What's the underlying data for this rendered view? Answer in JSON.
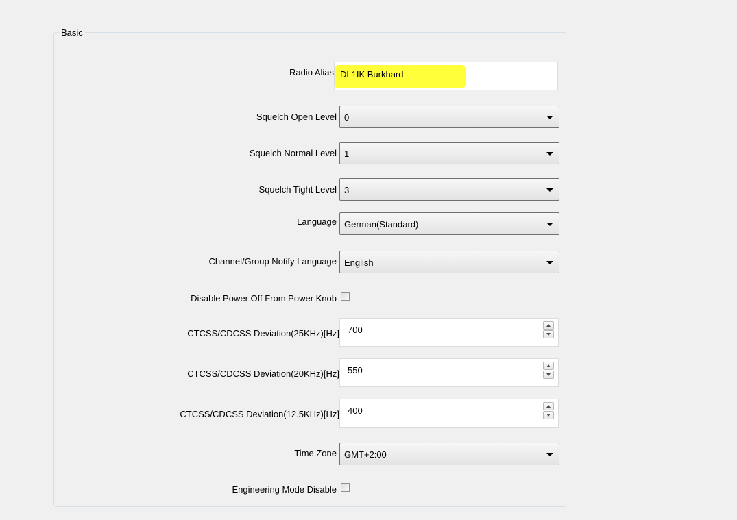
{
  "group": {
    "title": "Basic"
  },
  "fields": {
    "radio_alias": {
      "label": "Radio Alias",
      "value": "DL1IK Burkhard",
      "highlight_color": "#ffff3a"
    },
    "squelch_open": {
      "label": "Squelch Open Level",
      "value": "0"
    },
    "squelch_normal": {
      "label": "Squelch Normal Level",
      "value": "1"
    },
    "squelch_tight": {
      "label": "Squelch Tight Level",
      "value": "3"
    },
    "language": {
      "label": "Language",
      "value": "German(Standard)"
    },
    "notify_language": {
      "label": "Channel/Group Notify Language",
      "value": "English"
    },
    "disable_power_off": {
      "label": "Disable Power Off From Power Knob",
      "checked": false
    },
    "deviation_25": {
      "label": "CTCSS/CDCSS Deviation(25KHz)[Hz]",
      "value": "700"
    },
    "deviation_20": {
      "label": "CTCSS/CDCSS Deviation(20KHz)[Hz]",
      "value": "550"
    },
    "deviation_12_5": {
      "label": "CTCSS/CDCSS Deviation(12.5KHz)[Hz]",
      "value": "400"
    },
    "time_zone": {
      "label": "Time Zone",
      "value": "GMT+2:00"
    },
    "engineering_mode_disable": {
      "label": "Engineering Mode Disable",
      "checked": false
    }
  },
  "icons": {
    "dropdown": "chevron-down-icon",
    "spin_up": "spin-up-icon",
    "spin_down": "spin-down-icon"
  }
}
